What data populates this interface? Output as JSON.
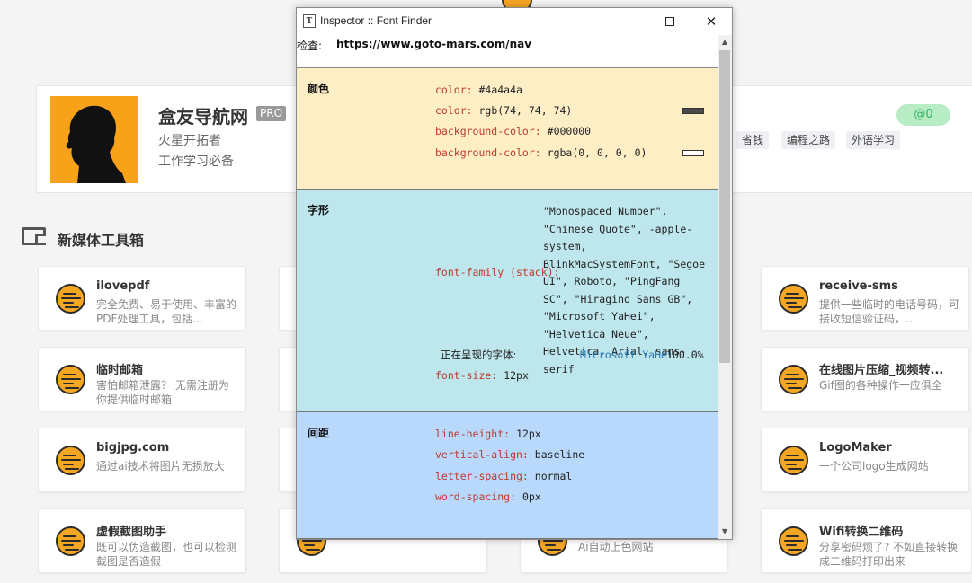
{
  "profile": {
    "name": "盒友导航网",
    "badge": "PRO",
    "line1": "火星开拓者",
    "line2": "工作学习必备",
    "tags": [
      "省钱",
      "编程之路",
      "外语学习"
    ],
    "like": "@0"
  },
  "section": {
    "title": "新媒体工具箱"
  },
  "tools": [
    {
      "title": "ilovepdf",
      "desc": "完全免费、易于使用、丰富的PDF处理工具，包括..."
    },
    {
      "title": "临时邮箱",
      "desc": "害怕邮箱泄露？ 无需注册为你提供临时邮箱"
    },
    {
      "title": "bigjpg.com",
      "desc": "通过ai技术将图片无损放大"
    },
    {
      "title": "虚假截图助手",
      "desc": "既可以伪造截图，也可以检测截图是否造假"
    },
    {
      "title": "receive-sms",
      "desc": "提供一些临时的电话号码，可接收短信验证码，..."
    },
    {
      "title": "在线图片压缩_视频转...",
      "desc": "Gif图的各种操作一应俱全"
    },
    {
      "title": "LogoMaker",
      "desc": "一个公司logo生成网站"
    },
    {
      "title": "Wifi转换二维码",
      "desc": "分享密码烦了? 不如直接转换成二维码打印出来"
    },
    {
      "title": "",
      "desc": "Ai自动上色网站"
    }
  ],
  "inspector": {
    "title": "Inspector :: Font Finder",
    "icon": "T",
    "url_label": "检查:",
    "url": "https://www.goto-mars.com/nav",
    "color_panel": {
      "label": "颜色",
      "rows": [
        {
          "key": "color:",
          "value": "#4a4a4a"
        },
        {
          "key": "color:",
          "value": "rgb(74, 74, 74)",
          "swatch": "#4a4a4a"
        },
        {
          "key": "background-color:",
          "value": "#000000"
        },
        {
          "key": "background-color:",
          "value": "rgba(0, 0, 0, 0)",
          "swatch": "transparent"
        }
      ]
    },
    "font_panel": {
      "label": "字形",
      "stack_key": "font-family (stack):",
      "stack_value": "\"Monospaced Number\", \"Chinese Quote\", -apple-system, BlinkMacSystemFont, \"Segoe UI\", Roboto, \"PingFang SC\", \"Hiragino Sans GB\", \"Microsoft YaHei\", \"Helvetica Neue\", Helvetica, Arial, sans-serif",
      "rendered_label": "正在呈现的字体:",
      "rendered_font": "Microsoft YaHei",
      "rendered_pct": "100.0%",
      "size_key": "font-size:",
      "size_value": "12px"
    },
    "spacing_panel": {
      "label": "间距",
      "rows": [
        {
          "key": "line-height:",
          "value": "12px"
        },
        {
          "key": "vertical-align:",
          "value": "baseline"
        },
        {
          "key": "letter-spacing:",
          "value": "normal"
        },
        {
          "key": "word-spacing:",
          "value": "0px"
        }
      ]
    }
  },
  "colors": {
    "color_panel_bg": "#fdeec5",
    "font_panel_bg": "#bde6ed",
    "spacing_panel_bg": "#b8d9fb",
    "property_key": "#c0392b",
    "rendered_font": "#2a7ab5",
    "tool_icon": "#f5a623",
    "avatar_bg": "#f8a21a"
  }
}
